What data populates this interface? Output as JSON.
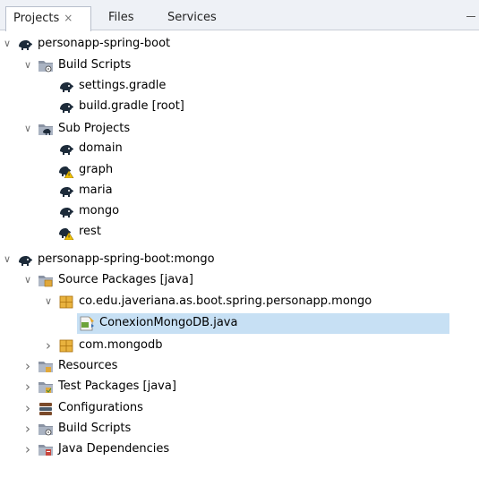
{
  "tabs": [
    {
      "label": "Projects",
      "close": "×"
    },
    {
      "label": "Files"
    },
    {
      "label": "Services"
    }
  ],
  "tree": [
    {
      "label": "personapp-spring-boot",
      "icon": "elephant-icon",
      "chevron": "down"
    },
    {
      "label": "Build Scripts",
      "icon": "folder-gradle-icon",
      "chevron": "down"
    },
    {
      "label": "settings.gradle",
      "icon": "elephant-icon"
    },
    {
      "label": "build.gradle [root]",
      "icon": "elephant-icon"
    },
    {
      "label": "Sub Projects",
      "icon": "folder-elephant-icon",
      "chevron": "down"
    },
    {
      "label": "domain",
      "icon": "elephant-icon"
    },
    {
      "label": "graph",
      "icon": "elephant-warning-icon"
    },
    {
      "label": "maria",
      "icon": "elephant-icon"
    },
    {
      "label": "mongo",
      "icon": "elephant-icon"
    },
    {
      "label": "rest",
      "icon": "elephant-warning-icon"
    },
    {
      "label": "personapp-spring-boot:mongo",
      "icon": "elephant-icon",
      "chevron": "down"
    },
    {
      "label": "Source Packages [java]",
      "icon": "source-folder-icon",
      "chevron": "down"
    },
    {
      "label": "co.edu.javeriana.as.boot.spring.personapp.mongo",
      "icon": "package-icon",
      "chevron": "down"
    },
    {
      "label": "ConexionMongoDB.java",
      "icon": "java-file-icon",
      "selected": true
    },
    {
      "label": "com.mongodb",
      "icon": "package-icon",
      "chevron": "right"
    },
    {
      "label": "Resources",
      "icon": "resources-folder-icon",
      "chevron": "right"
    },
    {
      "label": "Test Packages [java]",
      "icon": "test-folder-icon",
      "chevron": "right"
    },
    {
      "label": "Configurations",
      "icon": "configurations-icon",
      "chevron": "right"
    },
    {
      "label": "Build Scripts",
      "icon": "folder-gradle-icon",
      "chevron": "right"
    },
    {
      "label": "Java Dependencies",
      "icon": "jar-folder-icon",
      "chevron": "right"
    }
  ],
  "colors": {
    "selection": "#c7e0f4",
    "accent": "#0078d7",
    "tab_bar": "#eef1f6"
  }
}
